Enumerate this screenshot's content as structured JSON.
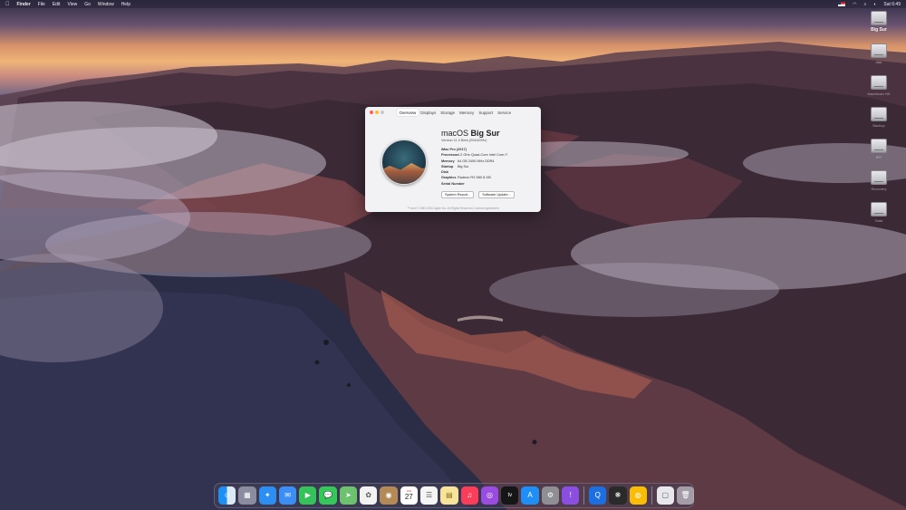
{
  "menubar": {
    "apple": "",
    "app": "Finder",
    "menus": [
      "File",
      "Edit",
      "View",
      "Go",
      "Window",
      "Help"
    ],
    "clock": "Sat 6:49"
  },
  "desktop": {
    "icons": [
      {
        "label": "Big Sur",
        "legible": true
      },
      {
        "label": "disk",
        "legible": false
      },
      {
        "label": "Macintosh HD",
        "legible": false
      },
      {
        "label": "Backup",
        "legible": false
      },
      {
        "label": "EFI",
        "legible": false
      },
      {
        "label": "Recovery",
        "legible": false
      },
      {
        "label": "Data",
        "legible": false
      }
    ]
  },
  "about": {
    "tabs": [
      "Overview",
      "Displays",
      "Storage",
      "Memory",
      "Support",
      "Service"
    ],
    "active_tab": "Overview",
    "title_light": "macOS",
    "title_bold": " Big Sur",
    "version": "Version 11.0 Beta (20A4299v)",
    "specs": [
      {
        "k": "iMac Pro (2017)",
        "v": ""
      },
      {
        "k": "Processor",
        "v": "4.2 GHz Quad-Core Intel Core i7"
      },
      {
        "k": "Memory",
        "v": "64 GB 2400 MHz DDR4"
      },
      {
        "k": "Startup Disk",
        "v": "Big Sur"
      },
      {
        "k": "Graphics",
        "v": "Radeon RX 580 8 GB"
      },
      {
        "k": "Serial Number",
        "v": ""
      }
    ],
    "buttons": {
      "report": "System Report...",
      "update": "Software Update..."
    },
    "footer": "™ and © 1983-2020 Apple Inc. All Rights Reserved. License Agreement"
  },
  "dock": {
    "calendar": {
      "month": "JUN",
      "day": "27"
    },
    "items": [
      {
        "name": "finder-icon",
        "glyph": "☺",
        "bg": "linear-gradient(90deg,#1e8ff5 50%,#dbe9f7 50%)"
      },
      {
        "name": "launchpad-icon",
        "glyph": "▦",
        "bg": "#8c8ca0"
      },
      {
        "name": "safari-icon",
        "glyph": "✦",
        "bg": "#2c8ef2"
      },
      {
        "name": "mail-icon",
        "glyph": "✉",
        "bg": "#3b8ef5"
      },
      {
        "name": "facetime-icon",
        "glyph": "▶",
        "bg": "#36c25a"
      },
      {
        "name": "messages-icon",
        "glyph": "💬",
        "bg": "#35c75a"
      },
      {
        "name": "maps-icon",
        "glyph": "➤",
        "bg": "#6cc26f"
      },
      {
        "name": "photos-icon",
        "glyph": "✿",
        "bg": "#f2f2f2"
      },
      {
        "name": "contacts-icon",
        "glyph": "◉",
        "bg": "#b38a55"
      },
      {
        "name": "calendar-icon",
        "glyph": "",
        "bg": "#ffffff"
      },
      {
        "name": "reminders-icon",
        "glyph": "☰",
        "bg": "#f5f5f5"
      },
      {
        "name": "notes-icon",
        "glyph": "▤",
        "bg": "#f7e39a"
      },
      {
        "name": "music-icon",
        "glyph": "♫",
        "bg": "#fa3e5a"
      },
      {
        "name": "podcasts-icon",
        "glyph": "◎",
        "bg": "#9a4be0"
      },
      {
        "name": "tv-icon",
        "glyph": "tv",
        "bg": "#161616"
      },
      {
        "name": "app-store-icon",
        "glyph": "A",
        "bg": "#1f8ff7"
      },
      {
        "name": "system-preferences-icon",
        "glyph": "⚙",
        "bg": "#8e8e93"
      },
      {
        "name": "feedback-icon",
        "glyph": "!",
        "bg": "#8a4fe0"
      },
      {
        "name": "quicktime-icon",
        "glyph": "Q",
        "bg": "#1b6fe0"
      },
      {
        "name": "davinci-icon",
        "glyph": "❋",
        "bg": "#2a2a2a"
      },
      {
        "name": "chrome-icon",
        "glyph": "◍",
        "bg": "#fbbc05"
      },
      {
        "name": "document-icon",
        "glyph": "▢",
        "bg": "#e8e8ec"
      },
      {
        "name": "trash-icon",
        "glyph": "🗑",
        "bg": "rgba(220,220,228,0.6)"
      }
    ]
  }
}
